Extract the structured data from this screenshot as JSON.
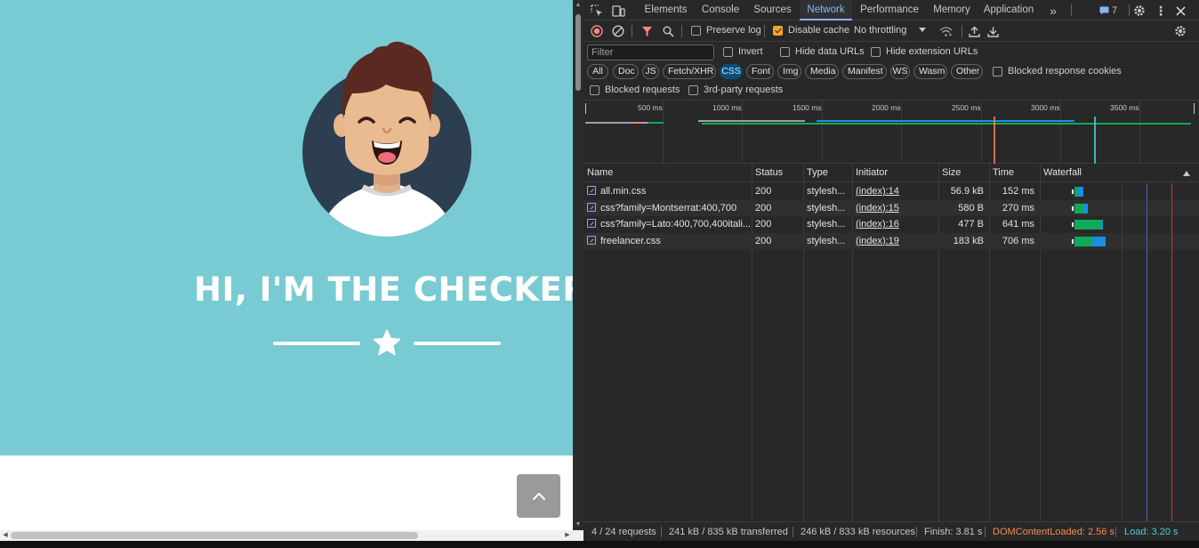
{
  "page": {
    "hero_title": "HI, I'M THE CHECKER!"
  },
  "devtools": {
    "tabs": [
      "Elements",
      "Console",
      "Sources",
      "Network",
      "Performance",
      "Memory",
      "Application"
    ],
    "active_tab": "Network",
    "issues_count": "7",
    "toolbar": {
      "preserve_log": "Preserve log",
      "disable_cache": "Disable cache",
      "throttling": "No throttling"
    },
    "filter": {
      "placeholder": "Filter",
      "invert": "Invert",
      "hide_data_urls": "Hide data URLs",
      "hide_extension_urls": "Hide extension URLs",
      "types": [
        "All",
        "Doc",
        "JS",
        "Fetch/XHR",
        "CSS",
        "Font",
        "Img",
        "Media",
        "Manifest",
        "WS",
        "Wasm",
        "Other"
      ],
      "active_type": "CSS",
      "blocked_response_cookies": "Blocked response cookies",
      "blocked_requests": "Blocked requests",
      "third_party_requests": "3rd-party requests"
    },
    "overview_ticks": [
      "500 ms",
      "1000 ms",
      "1500 ms",
      "2000 ms",
      "2500 ms",
      "3000 ms",
      "3500 ms"
    ],
    "columns": [
      "Name",
      "Status",
      "Type",
      "Initiator",
      "Size",
      "Time",
      "Waterfall"
    ],
    "rows": [
      {
        "name": "all.min.css",
        "status": "200",
        "type": "stylesh...",
        "initiator": "(index):14",
        "size": "56.9 kB",
        "time": "152 ms"
      },
      {
        "name": "css?family=Montserrat:400,700",
        "status": "200",
        "type": "stylesh...",
        "initiator": "(index):15",
        "size": "580 B",
        "time": "270 ms"
      },
      {
        "name": "css?family=Lato:400,700,400itali...",
        "status": "200",
        "type": "stylesh...",
        "initiator": "(index):16",
        "size": "477 B",
        "time": "641 ms"
      },
      {
        "name": "freelancer.css",
        "status": "200",
        "type": "stylesh...",
        "initiator": "(index):19",
        "size": "183 kB",
        "time": "706 ms"
      }
    ],
    "status_bar": {
      "requests": "4 / 24 requests",
      "transferred": "241 kB / 835 kB transferred",
      "resources": "246 kB / 833 kB resources",
      "finish": "Finish: 3.81 s",
      "dom_content_loaded": "DOMContentLoaded: 2.56 s",
      "load": "Load: 3.20 s"
    },
    "colors": {
      "accent": "#8ab4f8",
      "dcl": "#f28b54",
      "load": "#4dd0e1",
      "waterfall_wait": "#0fa958",
      "waterfall_download": "#1a8fe0"
    }
  }
}
